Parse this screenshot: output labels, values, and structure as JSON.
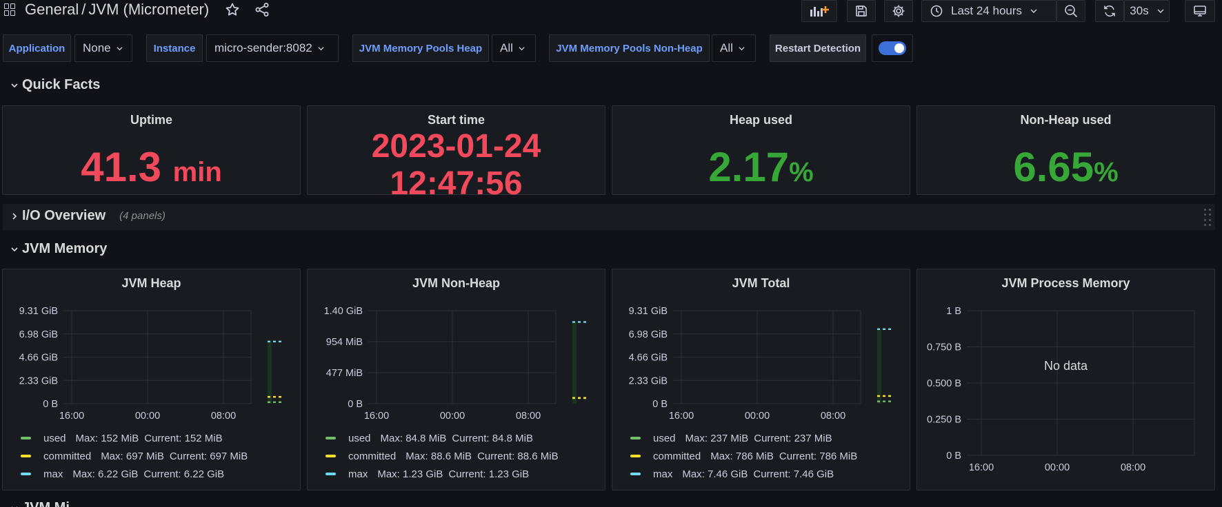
{
  "header": {
    "folder": "General",
    "separator": "/",
    "dashboard": "JVM (Micrometer)",
    "time_range": "Last 24 hours",
    "refresh": "30s"
  },
  "variables": [
    {
      "label": "Application",
      "value": "None"
    },
    {
      "label": "Instance",
      "value": "micro-sender:8082"
    },
    {
      "label": "JVM Memory Pools Heap",
      "value": "All"
    },
    {
      "label": "JVM Memory Pools Non-Heap",
      "value": "All"
    },
    {
      "label": "Restart Detection",
      "enabled": true
    }
  ],
  "rows": {
    "quick_facts": "Quick Facts",
    "io_overview": "I/O Overview",
    "io_overview_count": "(4 panels)",
    "jvm_memory": "JVM Memory",
    "next_row_partial": "JVM Mi"
  },
  "stats": [
    {
      "title": "Uptime",
      "value": "41.3",
      "unit": "min",
      "color": "#f2495c"
    },
    {
      "title": "Start time",
      "value": "2023-01-24",
      "value2": "12:47:56",
      "color": "#f2495c"
    },
    {
      "title": "Heap used",
      "value": "2.17",
      "unit": "%",
      "color": "#37a837"
    },
    {
      "title": "Non-Heap used",
      "value": "6.65",
      "unit": "%",
      "color": "#37a837"
    }
  ],
  "colors": {
    "used": "#73bf69",
    "committed": "#fade2a",
    "max": "#73d8e8",
    "accent": "#6e9fff"
  },
  "graphs": [
    {
      "title": "JVM Heap",
      "y_ticks": [
        "9.31 GiB",
        "6.98 GiB",
        "4.66 GiB",
        "2.33 GiB",
        "0 B"
      ],
      "x_ticks": [
        "16:00",
        "00:00",
        "08:00"
      ],
      "y_max_gib": 9.31,
      "series_levels_gib": {
        "used": 0.148,
        "committed": 0.681,
        "max": 6.22
      },
      "legend": [
        {
          "key": "used",
          "name": "used",
          "max": "Max: 152 MiB",
          "current": "Current: 152 MiB"
        },
        {
          "key": "committed",
          "name": "committed",
          "max": "Max: 697 MiB",
          "current": "Current: 697 MiB"
        },
        {
          "key": "max",
          "name": "max",
          "max": "Max: 6.22 GiB",
          "current": "Current: 6.22 GiB"
        }
      ]
    },
    {
      "title": "JVM Non-Heap",
      "y_ticks": [
        "1.40 GiB",
        "954 MiB",
        "477 MiB",
        "0 B"
      ],
      "x_ticks": [
        "16:00",
        "00:00",
        "08:00"
      ],
      "y_max_gib": 1.4,
      "series_levels_gib": {
        "used": 0.083,
        "committed": 0.087,
        "max": 1.23
      },
      "legend": [
        {
          "key": "used",
          "name": "used",
          "max": "Max: 84.8 MiB",
          "current": "Current: 84.8 MiB"
        },
        {
          "key": "committed",
          "name": "committed",
          "max": "Max: 88.6 MiB",
          "current": "Current: 88.6 MiB"
        },
        {
          "key": "max",
          "name": "max",
          "max": "Max: 1.23 GiB",
          "current": "Current: 1.23 GiB"
        }
      ]
    },
    {
      "title": "JVM Total",
      "y_ticks": [
        "9.31 GiB",
        "6.98 GiB",
        "4.66 GiB",
        "2.33 GiB",
        "0 B"
      ],
      "x_ticks": [
        "16:00",
        "00:00",
        "08:00"
      ],
      "y_max_gib": 9.31,
      "series_levels_gib": {
        "used": 0.231,
        "committed": 0.768,
        "max": 7.46
      },
      "legend": [
        {
          "key": "used",
          "name": "used",
          "max": "Max: 237 MiB",
          "current": "Current: 237 MiB"
        },
        {
          "key": "committed",
          "name": "committed",
          "max": "Max: 786 MiB",
          "current": "Current: 786 MiB"
        },
        {
          "key": "max",
          "name": "max",
          "max": "Max: 7.46 GiB",
          "current": "Current: 7.46 GiB"
        }
      ]
    },
    {
      "title": "JVM Process Memory",
      "y_ticks": [
        "1 B",
        "0.750 B",
        "0.500 B",
        "0.250 B",
        "0 B"
      ],
      "x_ticks": [
        "16:00",
        "00:00",
        "08:00"
      ],
      "no_data": "No data",
      "legend": []
    }
  ]
}
